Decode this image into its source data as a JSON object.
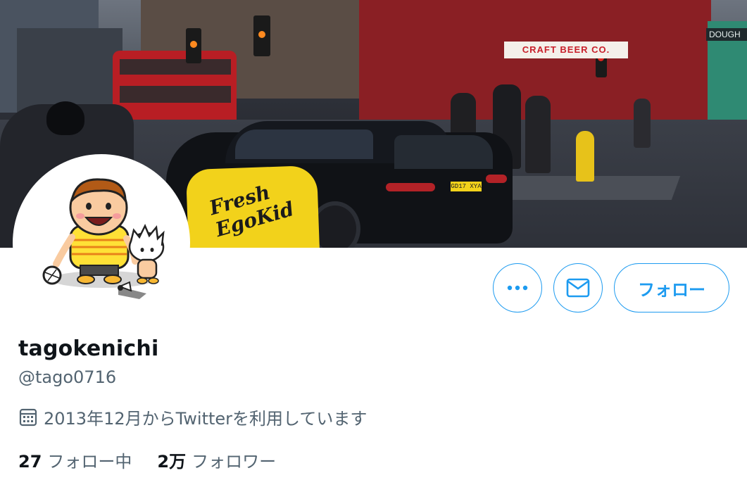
{
  "banner": {
    "sign_left": "CRAFT BEER CO.",
    "sign_right": "DOUGH",
    "cap_text": "Fresh EgoKid",
    "plate": "GD17 XYA"
  },
  "avatar": {
    "icon": "cartoon-avatar-icon"
  },
  "actions": {
    "more_icon": "more-icon",
    "dm_icon": "mail-icon",
    "follow_label": "フォロー"
  },
  "profile": {
    "name": "tagokenichi",
    "handle": "@tago0716",
    "joined_icon": "calendar-icon",
    "joined": "2013年12月からTwitterを利用しています"
  },
  "stats": {
    "following_count": "27",
    "following_label": "フォロー中",
    "followers_count": "2万",
    "followers_label": "フォロワー"
  },
  "colors": {
    "accent": "#1d9bf0",
    "secondary_text": "#536471",
    "primary_text": "#0f1419"
  }
}
